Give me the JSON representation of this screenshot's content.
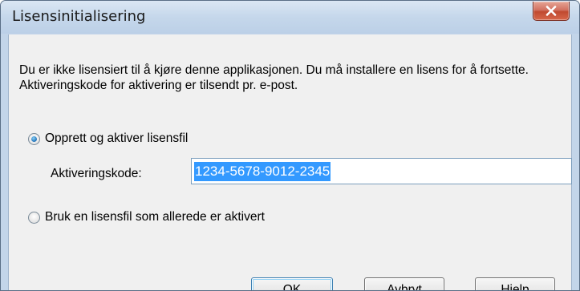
{
  "window": {
    "title": "Lisensinitialisering",
    "close_icon": "close-icon"
  },
  "message": "Du er ikke lisensiert til å kjøre denne applikasjonen. Du må installere en lisens for å fortsette. Aktiveringskode for aktivering er tilsendt pr. e-post.",
  "options": {
    "create": {
      "label": "Opprett og aktiver lisensfil",
      "selected": true
    },
    "existing": {
      "label": "Bruk en lisensfil som allerede er aktivert",
      "selected": false
    }
  },
  "activation": {
    "label": "Aktiveringskode:",
    "value": "1234-5678-9012-2345"
  },
  "buttons": {
    "ok": "OK",
    "cancel": "Avbryt",
    "help": "Hjelp"
  },
  "colors": {
    "selection": "#3399ff",
    "close_button": "#c04a30",
    "dialog_background": "#f0f0f0"
  }
}
